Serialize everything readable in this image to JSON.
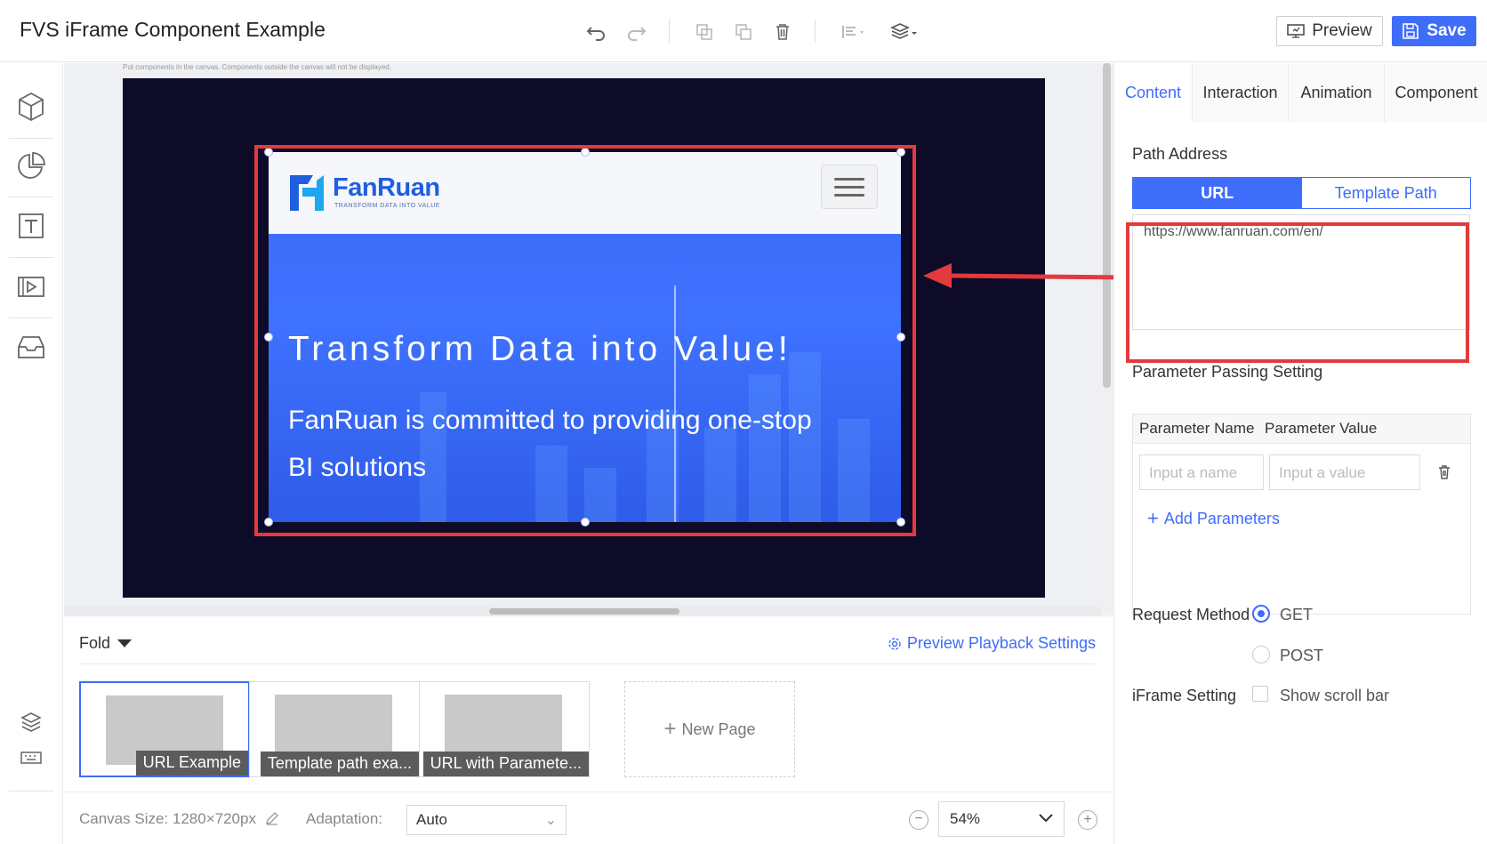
{
  "app": {
    "title": "FVS iFrame Component Example"
  },
  "toolbar": {
    "preview_label": "Preview",
    "save_label": "Save"
  },
  "canvas": {
    "hint": "Put components in the canvas. Components outside the canvas will not be displayed.",
    "iframe": {
      "logo_text": "FanRuan",
      "logo_sub": "TRANSFORM DATA INTO VALUE",
      "hero_title": "Transform Data into Value!",
      "hero_sub_line1": "FanRuan is committed to providing one-stop",
      "hero_sub_line2": "BI solutions"
    }
  },
  "pages": {
    "fold_label": "Fold",
    "preview_settings_label": "Preview Playback Settings",
    "items": [
      {
        "label": "URL Example",
        "active": true
      },
      {
        "label": "Template path exa...",
        "active": false
      },
      {
        "label": "URL with Paramete...",
        "active": false
      }
    ],
    "new_page_label": "New Page"
  },
  "bottom": {
    "canvas_size": "Canvas Size: 1280×720px",
    "adaptation_label": "Adaptation:",
    "adaptation_value": "Auto",
    "zoom_value": "54%"
  },
  "panel": {
    "tabs": [
      "Content",
      "Interaction",
      "Animation",
      "Component"
    ],
    "active_tab": "Content",
    "path_address_label": "Path Address",
    "seg_url": "URL",
    "seg_template": "Template Path",
    "url_value": "https://www.fanruan.com/en/",
    "param_setting_label": "Parameter Passing Setting",
    "param_name_header": "Parameter Name",
    "param_value_header": "Parameter Value",
    "param_name_placeholder": "Input a name",
    "param_value_placeholder": "Input a value",
    "add_param_label": "Add Parameters",
    "request_method_label": "Request Method",
    "method_get": "GET",
    "method_post": "POST",
    "selected_method": "GET",
    "iframe_setting_label": "iFrame Setting",
    "show_scroll_label": "Show scroll bar",
    "show_scroll_checked": false
  },
  "colors": {
    "accent": "#3e6dfa",
    "highlight": "#e23a3d",
    "canvas_bg": "#0e0b28"
  }
}
